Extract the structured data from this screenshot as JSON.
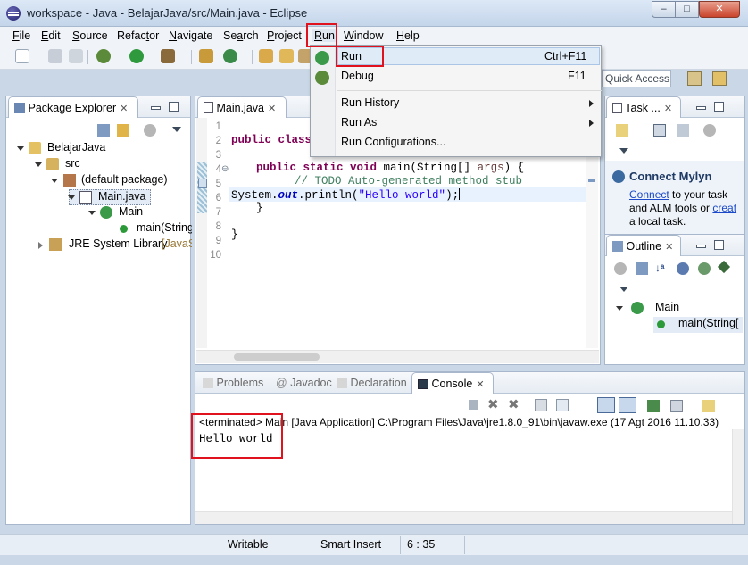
{
  "window": {
    "title": "workspace - Java - BelajarJava/src/Main.java - Eclipse",
    "min": "–",
    "max": "□",
    "close": "✕"
  },
  "menubar": [
    {
      "key": "F",
      "rest": "ile"
    },
    {
      "key": "E",
      "rest": "dit"
    },
    {
      "key": "S",
      "rest": "ource"
    },
    {
      "key": "",
      "pre": "Refac",
      "key2": "t",
      "rest": "or"
    },
    {
      "key": "N",
      "rest": "avigate"
    },
    {
      "key": "",
      "pre": "Se",
      "key2": "a",
      "rest": "rch"
    },
    {
      "key": "P",
      "rest": "roject"
    },
    {
      "key": "R",
      "rest": "un"
    },
    {
      "key": "W",
      "rest": "indow"
    },
    {
      "key": "H",
      "rest": "elp"
    }
  ],
  "quick_access": {
    "placeholder": "Quick Access"
  },
  "run_menu": {
    "items": [
      {
        "label": "Run",
        "shortcut": "Ctrl+F11"
      },
      {
        "label": "Debug",
        "shortcut": "F11"
      },
      {
        "label": "Run History",
        "submenu": true
      },
      {
        "label": "Run As",
        "submenu": true
      },
      {
        "label": "Run Configurations..."
      }
    ]
  },
  "package_explorer": {
    "tab_label": "Package Explorer",
    "tree": [
      {
        "label": "BelajarJava",
        "icon": "project-icon"
      },
      {
        "label": "src",
        "icon": "source-folder-icon"
      },
      {
        "label": "(default package)",
        "icon": "package-icon"
      },
      {
        "label": "Main.java",
        "icon": "java-file-icon"
      },
      {
        "label": "Main",
        "icon": "class-icon"
      },
      {
        "label": "main(String",
        "icon": "method-icon"
      },
      {
        "label": "JRE System Library",
        "suffix": "[JavaSE",
        "icon": "library-icon"
      }
    ]
  },
  "editor": {
    "tab_label": "Main.java",
    "line_numbers": [
      "1",
      "2",
      "3",
      "4",
      "5",
      "6",
      "7",
      "8",
      "9",
      "10"
    ],
    "lines": {
      "l2_kw": "public class",
      "l4_kw": "public static void",
      "l4_rest": " main(String[] ",
      "l4_arg": "args",
      "l4_end": ") {",
      "l5_cm": "// TODO Auto-generated method stub",
      "l6_a": "System.",
      "l6_out": "out",
      "l6_b": ".println(",
      "l6_str": "\"Hello world\"",
      "l6_c": ");",
      "l7": "}",
      "l9": "}"
    }
  },
  "task_list": {
    "tab_label": "Task ..."
  },
  "mylyn": {
    "title": "Connect Mylyn",
    "link1": "Connect",
    "text1": " to your task",
    "text2": "and ALM tools or ",
    "link2": "creat",
    "text3": "a local task."
  },
  "outline": {
    "tab_label": "Outline",
    "tree": [
      {
        "label": "Main"
      },
      {
        "label": "main(String["
      }
    ]
  },
  "bottom_tabs": [
    {
      "label": "Problems"
    },
    {
      "label": "Javadoc"
    },
    {
      "label": "Declaration"
    },
    {
      "label": "Console",
      "active": true
    }
  ],
  "console": {
    "terminated": "<terminated> Main [Java Application] C:\\Program Files\\Java\\jre1.8.0_91\\bin\\javaw.exe (17 Agt 2016 11.10.33)",
    "output": "Hello world"
  },
  "statusbar": {
    "writable": "Writable",
    "insert": "Smart Insert",
    "position": "6 : 35"
  }
}
